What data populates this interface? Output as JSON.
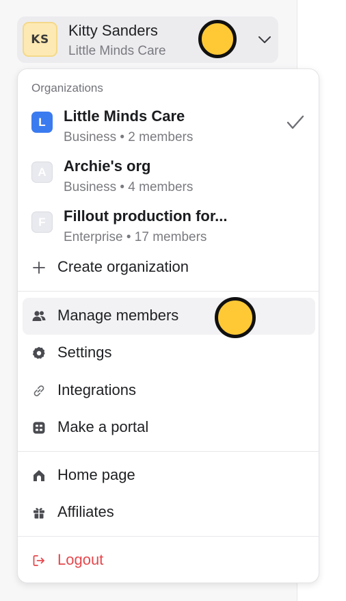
{
  "account": {
    "initials": "KS",
    "name": "Kitty Sanders",
    "organization": "Little Minds Care"
  },
  "menu": {
    "section_label": "Organizations",
    "organizations": [
      {
        "badge": "L",
        "name": "Little Minds Care",
        "meta": "Business • 2 members",
        "selected": true
      },
      {
        "badge": "A",
        "name": "Archie's org",
        "meta": "Business • 4 members",
        "selected": false
      },
      {
        "badge": "F",
        "name": "Fillout production for...",
        "meta": "Enterprise • 17 members",
        "selected": false
      }
    ],
    "create_label": "Create organization",
    "items": [
      {
        "label": "Manage members",
        "icon": "users-icon"
      },
      {
        "label": "Settings",
        "icon": "gear-icon"
      },
      {
        "label": "Integrations",
        "icon": "link-icon"
      },
      {
        "label": "Make a portal",
        "icon": "portal-icon"
      }
    ],
    "items2": [
      {
        "label": "Home page",
        "icon": "home-icon"
      },
      {
        "label": "Affiliates",
        "icon": "gift-icon"
      }
    ],
    "logout_label": "Logout"
  },
  "colors": {
    "accent": "#3b7bf0",
    "danger": "#e5484d",
    "cursor": "#ffc936",
    "avatar_bg": "#fde9b3"
  }
}
